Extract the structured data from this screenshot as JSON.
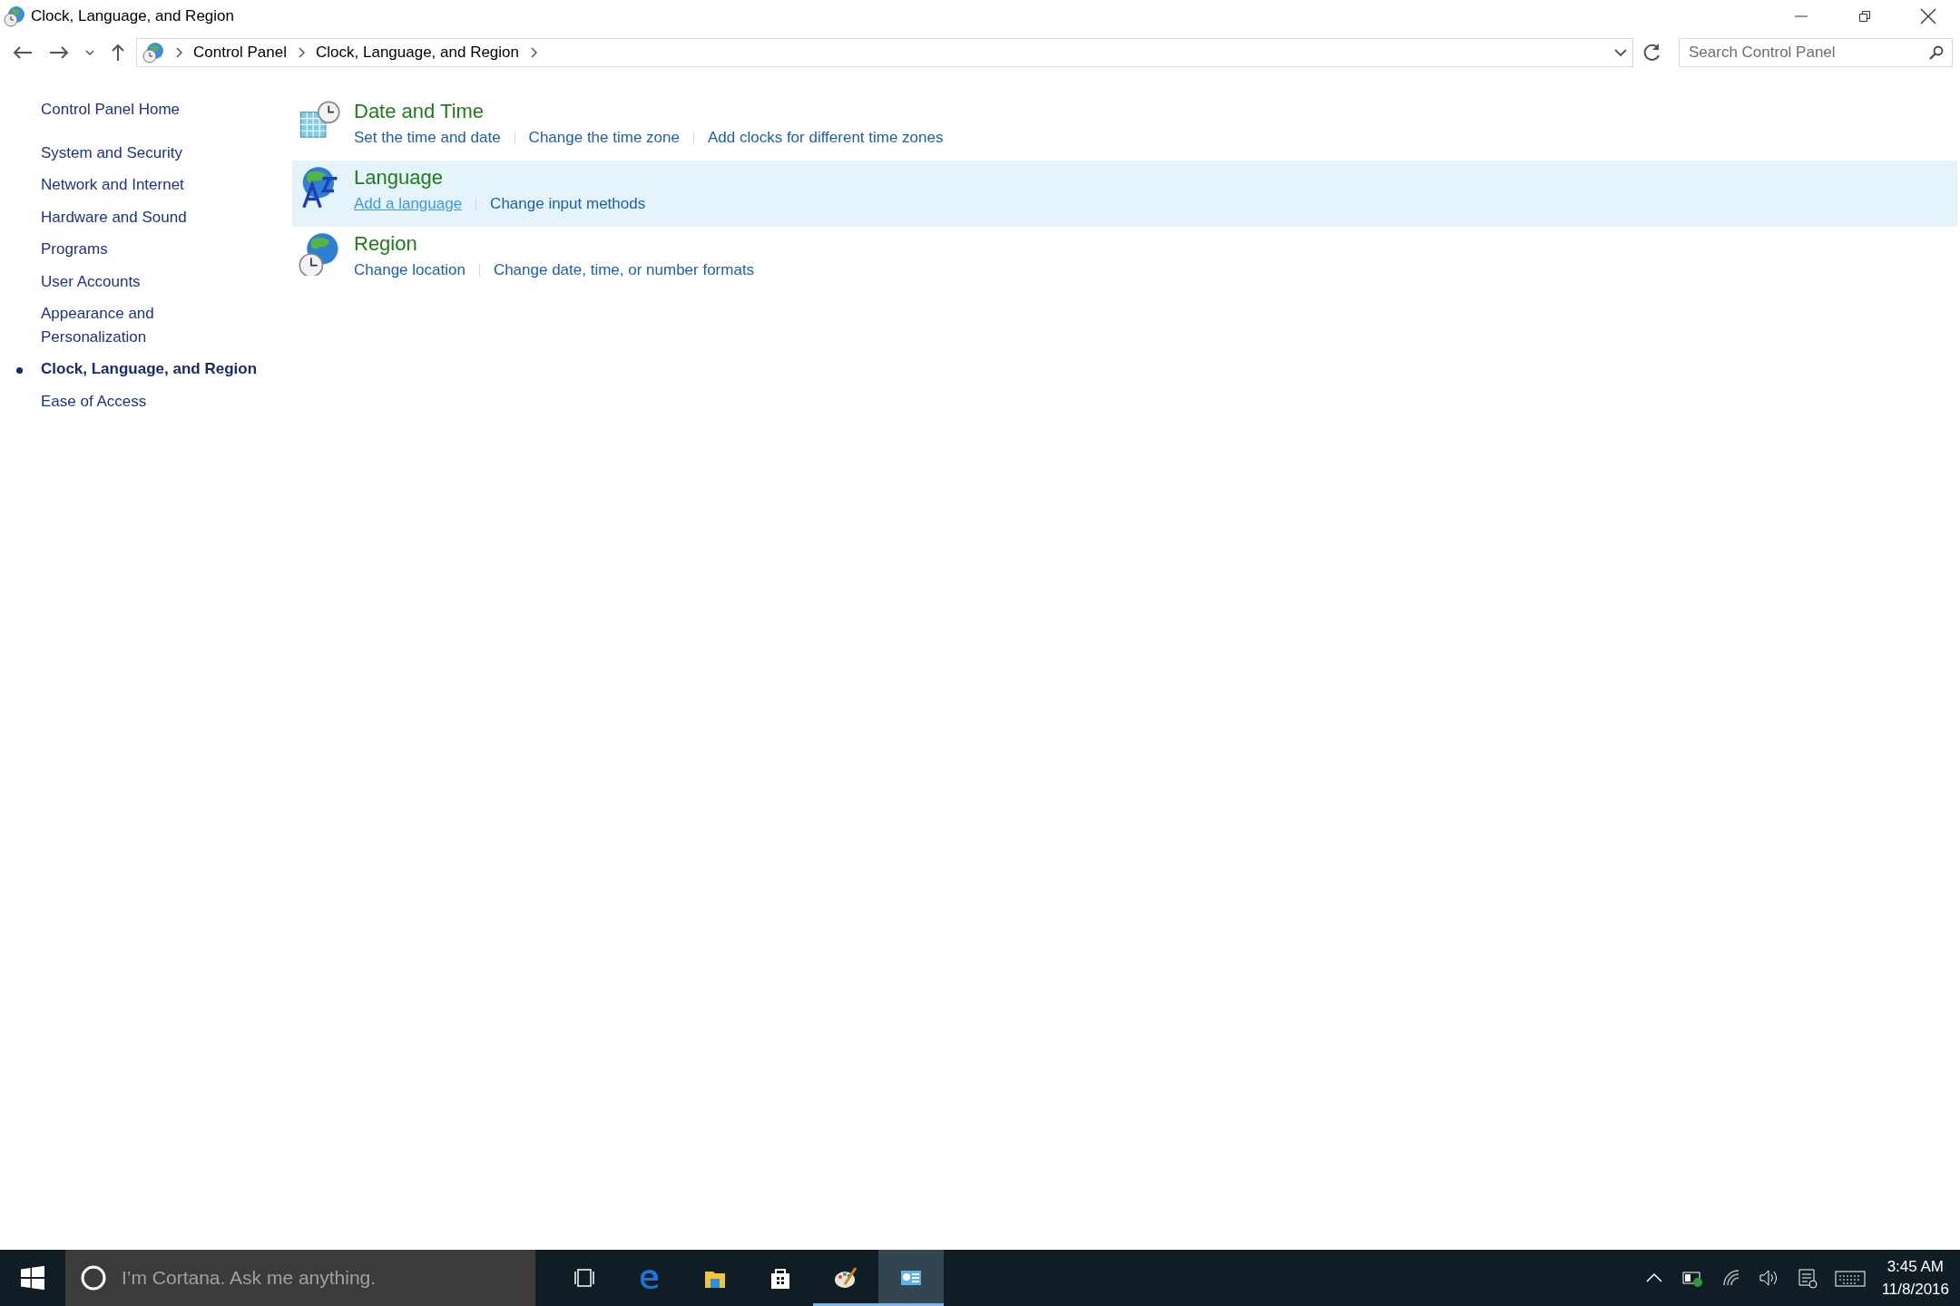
{
  "window": {
    "title": "Clock, Language, and Region"
  },
  "address_bar": {
    "breadcrumbs": [
      "Control Panel",
      "Clock, Language, and Region"
    ]
  },
  "search": {
    "placeholder": "Search Control Panel"
  },
  "sidebar": {
    "home": "Control Panel Home",
    "items": [
      {
        "label": "System and Security",
        "selected": false
      },
      {
        "label": "Network and Internet",
        "selected": false
      },
      {
        "label": "Hardware and Sound",
        "selected": false
      },
      {
        "label": "Programs",
        "selected": false
      },
      {
        "label": "User Accounts",
        "selected": false
      },
      {
        "label": "Appearance and Personalization",
        "selected": false
      },
      {
        "label": "Clock, Language, and Region",
        "selected": true
      },
      {
        "label": "Ease of Access",
        "selected": false
      }
    ]
  },
  "categories": [
    {
      "kind": "datetime",
      "title": "Date and Time",
      "hovered": false,
      "links": [
        {
          "label": "Set the time and date",
          "hovered": false
        },
        {
          "label": "Change the time zone",
          "hovered": false
        },
        {
          "label": "Add clocks for different time zones",
          "hovered": false
        }
      ]
    },
    {
      "kind": "language",
      "title": "Language",
      "hovered": true,
      "links": [
        {
          "label": "Add a language",
          "hovered": true
        },
        {
          "label": "Change input methods",
          "hovered": false
        }
      ]
    },
    {
      "kind": "region",
      "title": "Region",
      "hovered": false,
      "links": [
        {
          "label": "Change location",
          "hovered": false
        },
        {
          "label": "Change date, time, or number formats",
          "hovered": false
        }
      ]
    }
  ],
  "taskbar": {
    "search_placeholder": "I’m Cortana. Ask me anything.",
    "apps": [
      {
        "kind": "taskview",
        "running": false,
        "selected": false
      },
      {
        "kind": "edge",
        "running": false,
        "selected": false
      },
      {
        "kind": "explorer",
        "running": false,
        "selected": false
      },
      {
        "kind": "store",
        "running": false,
        "selected": false
      },
      {
        "kind": "paint",
        "running": true,
        "selected": false
      },
      {
        "kind": "controlpanel",
        "running": true,
        "selected": true
      }
    ],
    "time": "3:45 AM",
    "date": "11/8/2016"
  }
}
